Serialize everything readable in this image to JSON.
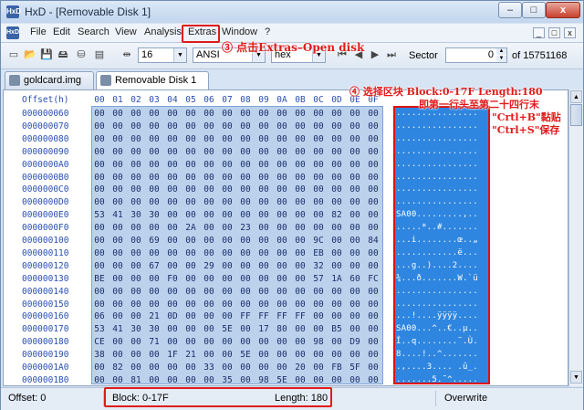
{
  "window": {
    "title": "HxD - [Removable Disk 1]",
    "app_icon": "HxD",
    "buttons": [
      "–",
      "□",
      "x"
    ]
  },
  "menu": {
    "icon": "HxD",
    "items": [
      "File",
      "Edit",
      "Search",
      "View",
      "Analysis",
      "Extras",
      "Window",
      "?"
    ],
    "mdi_buttons": [
      "_",
      "□",
      "x"
    ]
  },
  "toolbar": {
    "bytes_per_row": "16",
    "charset": "ANSI",
    "offset_base": "hex",
    "sector_label": "Sector",
    "sector_value": "0",
    "sector_total": "of 15751168"
  },
  "tabs": [
    {
      "label": "goldcard.img"
    },
    {
      "label": "Removable Disk 1"
    }
  ],
  "hex_header": {
    "offset_label": "Offset(h)",
    "columns": [
      "00",
      "01",
      "02",
      "03",
      "04",
      "05",
      "06",
      "07",
      "08",
      "09",
      "0A",
      "0B",
      "0C",
      "0D",
      "0E",
      "0F"
    ]
  },
  "rows": [
    {
      "offset": "000000060",
      "bytes": "00 00 00 00 00 00 00 00 00 00 00 00 00 00 00 00",
      "text": "................"
    },
    {
      "offset": "000000070",
      "bytes": "00 00 00 00 00 00 00 00 00 00 00 00 00 00 00 00",
      "text": "................"
    },
    {
      "offset": "000000080",
      "bytes": "00 00 00 00 00 00 00 00 00 00 00 00 00 00 00 00",
      "text": "................"
    },
    {
      "offset": "000000090",
      "bytes": "00 00 00 00 00 00 00 00 00 00 00 00 00 00 00 00",
      "text": "................"
    },
    {
      "offset": "0000000A0",
      "bytes": "00 00 00 00 00 00 00 00 00 00 00 00 00 00 00 00",
      "text": "................"
    },
    {
      "offset": "0000000B0",
      "bytes": "00 00 00 00 00 00 00 00 00 00 00 00 00 00 00 00",
      "text": "................"
    },
    {
      "offset": "0000000C0",
      "bytes": "00 00 00 00 00 00 00 00 00 00 00 00 00 00 00 00",
      "text": "................"
    },
    {
      "offset": "0000000D0",
      "bytes": "00 00 00 00 00 00 00 00 00 00 00 00 00 00 00 00",
      "text": "................"
    },
    {
      "offset": "0000000E0",
      "bytes": "53 41 30 30 00 00 00 00 00 00 00 00 00 82 00 00",
      "text": "SA00.........,.."
    },
    {
      "offset": "0000000F0",
      "bytes": "00 00 00 00 00 2A 00 00 23 00 00 00 00 00 00 00",
      "text": ".....*..#......."
    },
    {
      "offset": "000000100",
      "bytes": "00 00 00 69 00 00 00 00 00 00 00 00 9C 00 00 84",
      "text": "...i........œ..„"
    },
    {
      "offset": "000000110",
      "bytes": "00 00 00 00 00 00 00 00 00 00 00 00 EB 00 00 00",
      "text": "............ë..."
    },
    {
      "offset": "000000120",
      "bytes": "00 00 00 67 00 00 29 00 00 00 00 00 32 00 00 00",
      "text": "...g..)....2...."
    },
    {
      "offset": "000000130",
      "bytes": "BE 00 00 00 F0 00 00 00 00 00 00 00 57 1A 60 FC",
      "text": "¾...ð.......W.`ü"
    },
    {
      "offset": "000000140",
      "bytes": "00 00 00 00 00 00 00 00 00 00 00 00 00 00 00 00",
      "text": "................"
    },
    {
      "offset": "000000150",
      "bytes": "00 00 00 00 00 00 00 00 00 00 00 00 00 00 00 00",
      "text": "................"
    },
    {
      "offset": "000000160",
      "bytes": "06 00 00 21 0D 00 00 00 FF FF FF FF 00 00 00 00",
      "text": "...!....ÿÿÿÿ...."
    },
    {
      "offset": "000000170",
      "bytes": "53 41 30 30 00 00 00 5E 00 17 80 00 00 B5 00 00",
      "text": "SA00...^..€..µ.."
    },
    {
      "offset": "000000180",
      "bytes": "CE 00 00 71 00 00 00 00 00 00 00 00 98 00 D9 00",
      "text": "Î..q........˜.Ù."
    },
    {
      "offset": "000000190",
      "bytes": "38 00 00 00 1F 21 00 00 5E 00 00 00 00 00 00 00",
      "text": "8....!..^......."
    },
    {
      "offset": "0000001A0",
      "bytes": "00 82 00 00 00 00 33 00 00 00 00 20 00 FB 5F 00",
      "text": ".‚....3.... .û_."
    },
    {
      "offset": "0000001B0",
      "bytes": "00 00 81 00 00 00 00 35 00 98 5E 00 00 00 00 00",
      "text": ".......5.˜^....."
    }
  ],
  "status": {
    "offset": "Offset: 0",
    "block": "Block: 0-17F",
    "length": "Length: 180",
    "mode": "Overwrite"
  },
  "annotations": {
    "step3": "③ 点击Extras–Open disk",
    "step4_line1": "④ 选择区块 Block:0-17F Length:180",
    "step4_line2": "即第一行头至第二十四行末",
    "step4_line3": "\"Crtl+B\"黏贴",
    "step4_line4": "\"Ctrl+S\"保存"
  },
  "colors": {
    "annotation_red": "#e01b1b",
    "selection_blue": "#2e86e0",
    "offset_blue": "#2a4fb0"
  }
}
